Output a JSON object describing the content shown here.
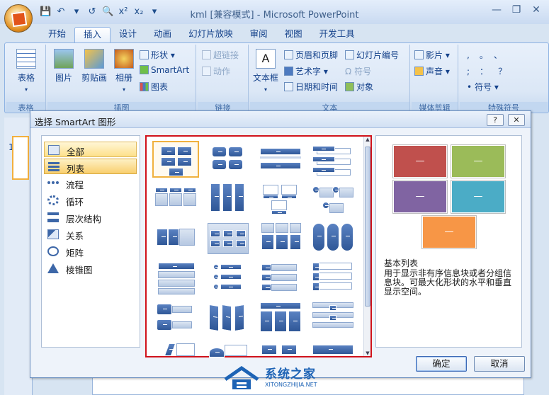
{
  "window": {
    "title": "kml [兼容模式] - Microsoft PowerPoint",
    "controls": [
      "—",
      "❐",
      "✕"
    ]
  },
  "qat": [
    "💾",
    "↶",
    "▾",
    "↺",
    "🔍",
    "x²",
    "x₂",
    "▾"
  ],
  "tabs": [
    "开始",
    "插入",
    "设计",
    "动画",
    "幻灯片放映",
    "审阅",
    "视图",
    "开发工具"
  ],
  "active_tab": "插入",
  "ribbon": {
    "table": {
      "label": "表格",
      "group": "表格"
    },
    "illustrations": {
      "picture": "图片",
      "clipart": "剪贴画",
      "album": "相册",
      "shapes": "形状",
      "smartart": "SmartArt",
      "chart": "图表",
      "group": "插图"
    },
    "links": {
      "hyperlink": "超链接",
      "action": "动作",
      "group": "链接"
    },
    "text": {
      "textbox": "文本框",
      "headerfooter": "页眉和页脚",
      "wordart": "艺术字",
      "datetime": "日期和时间",
      "slidenum": "幻灯片编号",
      "symbol": "符号",
      "object": "对象",
      "group": "文本"
    },
    "media": {
      "movie": "影片",
      "sound": "声音",
      "group": "媒体剪辑"
    },
    "special": {
      "chars": [
        ",",
        "。",
        "、",
        ";",
        "：",
        "？"
      ],
      "symbol": "符号",
      "group": "特殊符号"
    }
  },
  "slides": {
    "number": "1"
  },
  "dialog": {
    "title": "选择 SmartArt 图形",
    "help": "?",
    "close": "✕",
    "categories": [
      "全部",
      "列表",
      "流程",
      "循环",
      "层次结构",
      "关系",
      "矩阵",
      "棱锥图"
    ],
    "selected_category": "全部",
    "hover_category": "列表",
    "preview": {
      "name": "基本列表",
      "description": "用于显示非有序信息块或者分组信息块。可最大化形状的水平和垂直显示空间。",
      "dash": "—",
      "colors": [
        "#c0504d",
        "#9bbb59",
        "#8064a2",
        "#4bacc6",
        "#f79646"
      ]
    },
    "ok": "确定",
    "cancel": "取消"
  },
  "watermark": {
    "cn": "系统之家",
    "en": "XITONGZHIJIA.NET"
  }
}
